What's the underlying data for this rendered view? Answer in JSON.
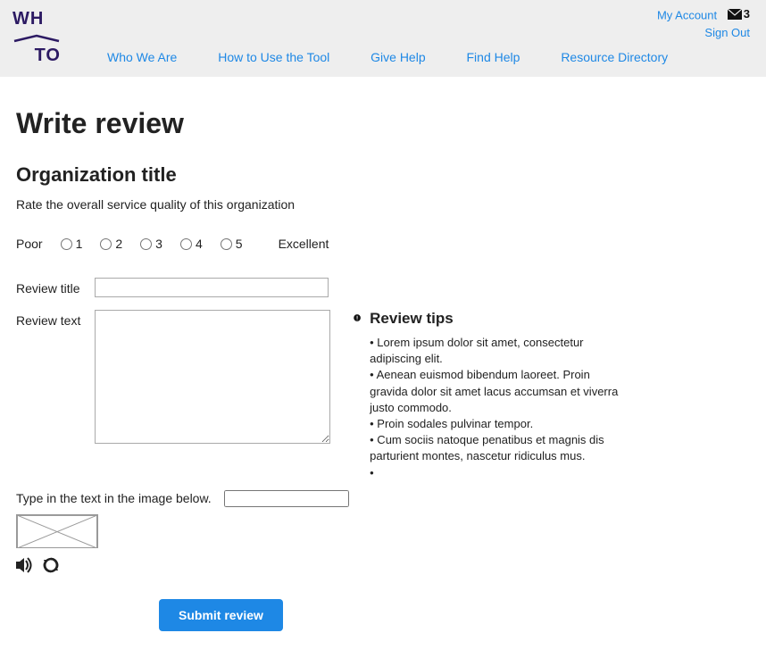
{
  "header": {
    "logo_top": "WH",
    "logo_bottom": "TO",
    "my_account": "My Account",
    "sign_out": "Sign Out",
    "mail_count": "3",
    "nav": {
      "who": "Who We Are",
      "how": "How to Use the Tool",
      "give": "Give Help",
      "find": "Find Help",
      "dir": "Resource Directory"
    }
  },
  "page": {
    "title": "Write review",
    "org_title": "Organization title",
    "rate_instruction": "Rate the overall service quality of this organization",
    "rating": {
      "poor": "Poor",
      "excellent": "Excellent",
      "o1": "1",
      "o2": "2",
      "o3": "3",
      "o4": "4",
      "o5": "5"
    },
    "labels": {
      "review_title": "Review title",
      "review_text": "Review text",
      "captcha": "Type in the text in the image below."
    },
    "tips": {
      "heading": "Review tips",
      "t1": "• Lorem ipsum dolor sit amet, consectetur adipiscing elit.",
      "t2": "• Aenean euismod bibendum laoreet. Proin gravida dolor sit amet lacus accumsan et viverra justo commodo.",
      "t3": "• Proin sodales pulvinar tempor.",
      "t4": "• Cum sociis natoque penatibus et magnis dis parturient montes, nascetur ridiculus mus.",
      "t5": "•"
    },
    "submit": "Submit review"
  }
}
